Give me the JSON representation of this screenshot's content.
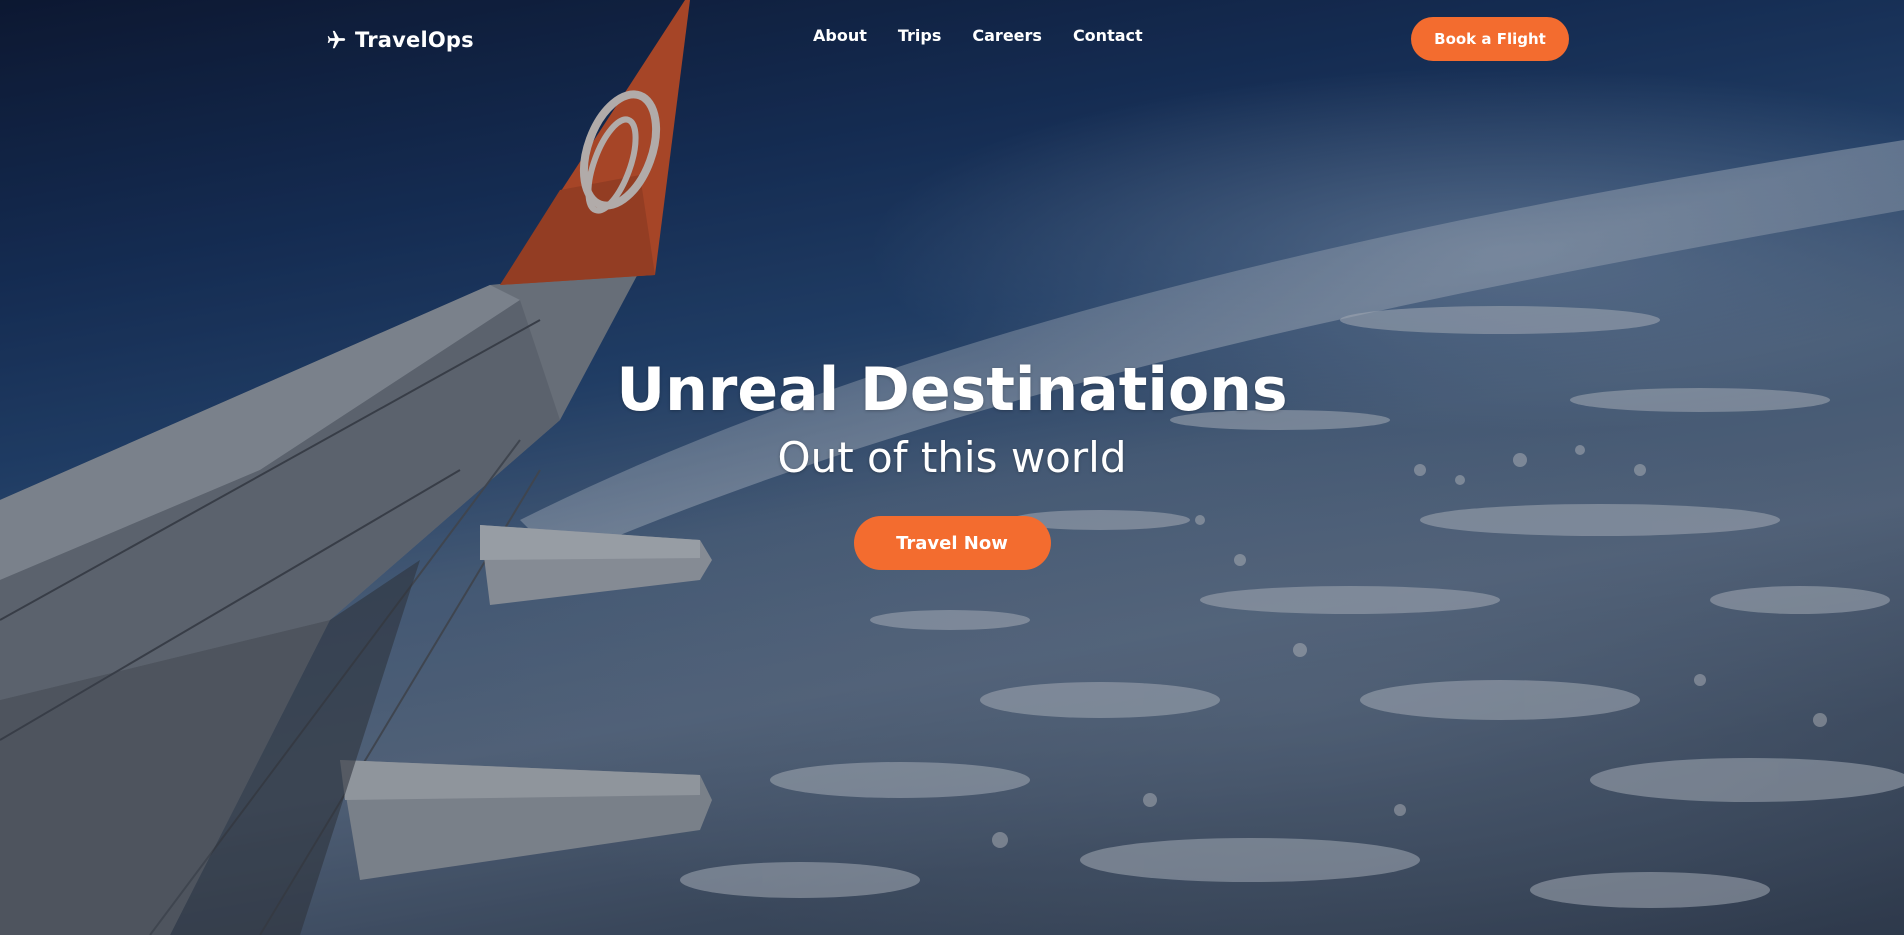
{
  "brand": {
    "name": "TravelOps",
    "icon": "airplane-icon"
  },
  "nav": {
    "links": [
      "About",
      "Trips",
      "Careers",
      "Contact"
    ],
    "cta_label": "Book a Flight"
  },
  "hero": {
    "title": "Unreal Destinations",
    "subtitle": "Out of this world",
    "cta_label": "Travel Now",
    "background": "aerial-view-airplane-wing-over-clouds"
  },
  "colors": {
    "accent": "#f36c2f",
    "text": "#ffffff",
    "sky_dark": "#0f1c3a"
  }
}
